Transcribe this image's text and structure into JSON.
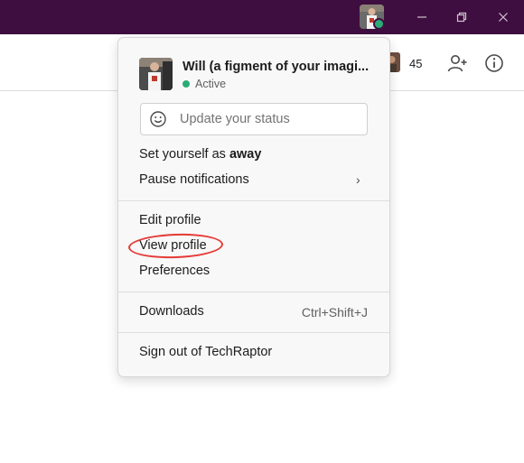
{
  "menu": {
    "profile": {
      "name": "Will (a figment of your imagi...",
      "presence": "Active"
    },
    "status_input": {
      "placeholder": "Update your status"
    },
    "set_away": {
      "prefix": "Set yourself as ",
      "bold": "away"
    },
    "pause_notifications": "Pause notifications",
    "edit_profile": "Edit profile",
    "view_profile": "View profile",
    "preferences": "Preferences",
    "downloads": {
      "label": "Downloads",
      "shortcut": "Ctrl+Shift+J"
    },
    "sign_out": "Sign out of TechRaptor"
  },
  "header": {
    "member_count": "45"
  },
  "colors": {
    "titlebar": "#3f0e40",
    "active_green": "#2bac76",
    "highlight_red": "#e53935"
  },
  "icons": {
    "window": [
      "minimize-icon",
      "restore-icon",
      "close-icon"
    ],
    "header": [
      "add-member-icon",
      "info-icon"
    ],
    "status": "smiley-icon",
    "submenu": "chevron-right-icon"
  }
}
